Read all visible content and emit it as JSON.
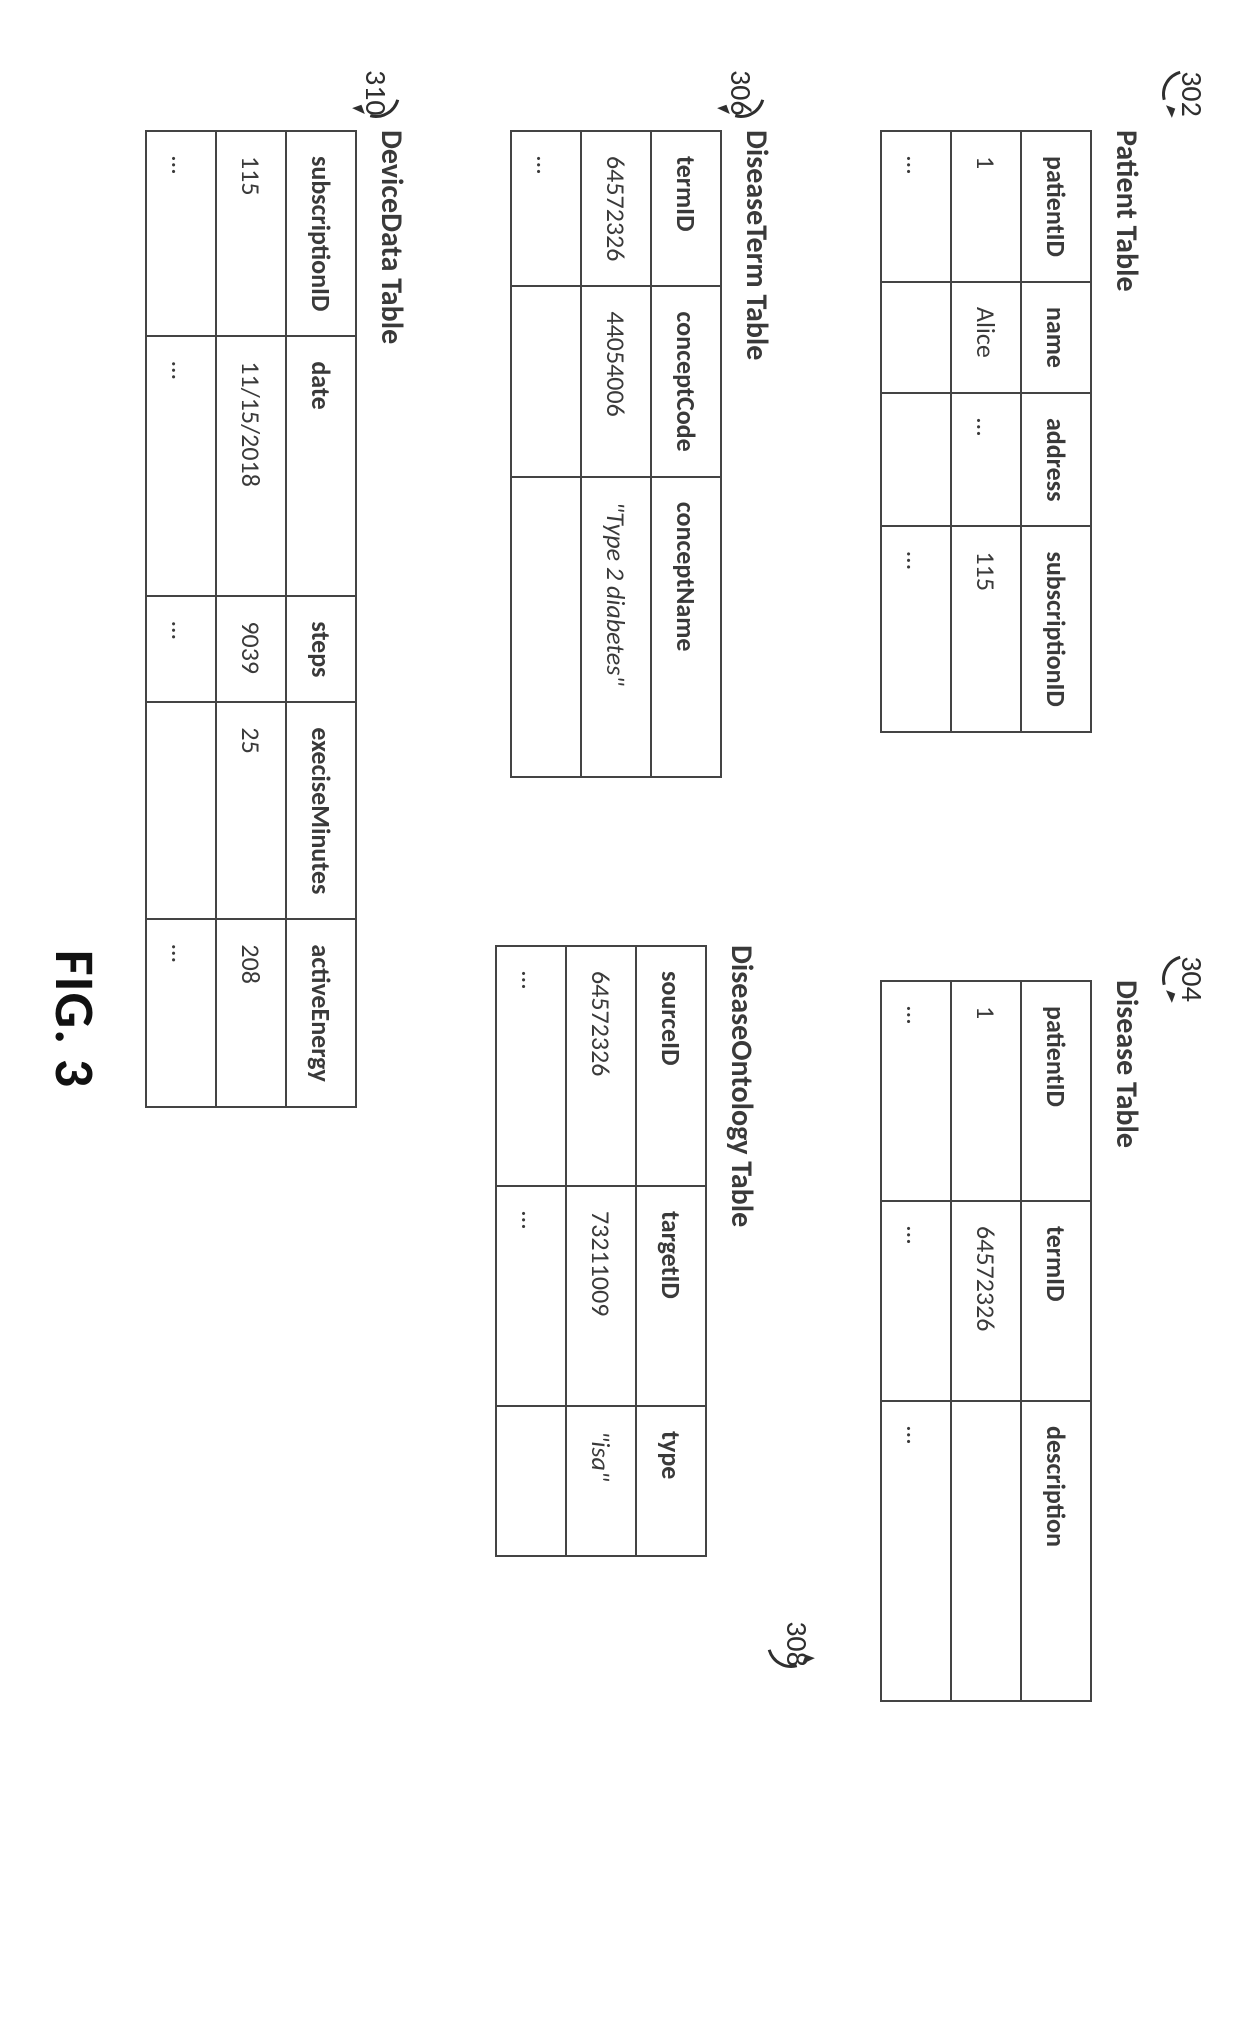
{
  "refs": {
    "r302": "302",
    "r304": "304",
    "r306": "306",
    "r308": "308",
    "r310": "310"
  },
  "tables": {
    "patient": {
      "title": "Patient Table",
      "headers": [
        "patientID",
        "name",
        "address",
        "subscriptionID"
      ],
      "rows": [
        [
          "1",
          "Alice",
          "…",
          "115"
        ],
        [
          "…",
          "",
          "",
          "…"
        ]
      ]
    },
    "disease": {
      "title": "Disease Table",
      "headers": [
        "patientID",
        "termID",
        "description"
      ],
      "rows": [
        [
          "1",
          "64572326",
          ""
        ],
        [
          "…",
          "…",
          "…"
        ]
      ]
    },
    "diseaseterm": {
      "title": "DiseaseTerm Table",
      "headers": [
        "termID",
        "conceptCode",
        "conceptName"
      ],
      "rows": [
        [
          "64572326",
          "44054006",
          "\"Type 2 diabetes\""
        ],
        [
          "…",
          "",
          ""
        ]
      ]
    },
    "ontology": {
      "title": "DiseaseOntology Table",
      "headers": [
        "sourceID",
        "targetID",
        "type"
      ],
      "rows": [
        [
          "64572326",
          "73211009",
          "\"isa\""
        ],
        [
          "…",
          "…",
          ""
        ]
      ]
    },
    "devicedata": {
      "title": "DeviceData Table",
      "headers": [
        "subscriptionID",
        "date",
        "steps",
        "execiseMinutes",
        "activeEnergy"
      ],
      "rows": [
        [
          "115",
          "11/15/2018",
          "9039",
          "25",
          "208"
        ],
        [
          "…",
          "…",
          "…",
          "",
          "…"
        ]
      ]
    }
  },
  "figure_caption": "FIG. 3"
}
